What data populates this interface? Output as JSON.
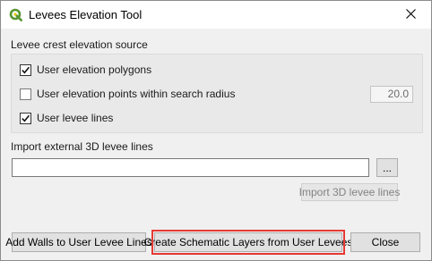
{
  "window": {
    "title": "Levees Elevation Tool",
    "app_icon": "qgis-icon",
    "close_icon": "close-icon"
  },
  "crest_source": {
    "heading": "Levee crest elevation source",
    "options": [
      {
        "label": "User elevation polygons",
        "checked": true,
        "enabled": true
      },
      {
        "label": "User elevation points within search radius",
        "checked": false,
        "enabled": true
      },
      {
        "label": "User levee lines",
        "checked": true,
        "enabled": true
      }
    ],
    "search_radius_value": "20.0"
  },
  "import": {
    "heading": "Import external 3D levee lines",
    "path_value": "",
    "path_placeholder": "",
    "browse_label": "...",
    "import_button_label": "Import 3D levee lines",
    "import_enabled": false
  },
  "footer": {
    "add_walls_label": "Add Walls to User Levee Lines",
    "create_schematic_label": "Create Schematic Layers from User Levees",
    "close_label": "Close"
  },
  "colors": {
    "highlight": "#e53935",
    "qgis_green": "#589632",
    "qgis_yellow": "#eec90d"
  }
}
